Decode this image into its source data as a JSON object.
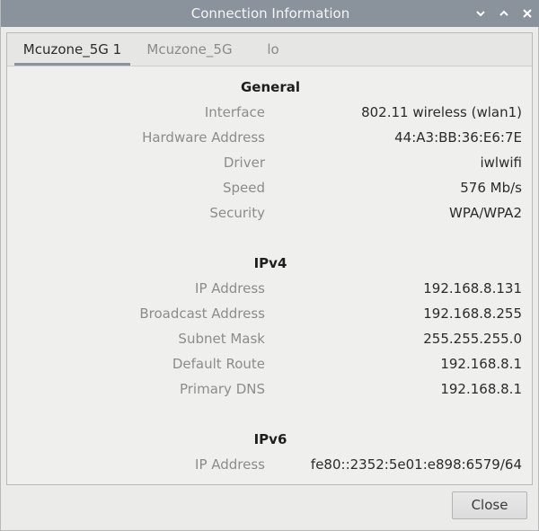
{
  "window": {
    "title": "Connection Information"
  },
  "titlebar_icons": {
    "minimize": "chevron-down-icon",
    "maximize": "chevron-up-icon",
    "close": "close-icon"
  },
  "tabs": [
    {
      "label": "Mcuzone_5G 1",
      "active": true
    },
    {
      "label": "Mcuzone_5G",
      "active": false
    },
    {
      "label": "lo",
      "active": false
    }
  ],
  "general": {
    "title": "General",
    "rows": [
      {
        "label": "Interface",
        "value": "802.11 wireless (wlan1)"
      },
      {
        "label": "Hardware Address",
        "value": "44:A3:BB:36:E6:7E"
      },
      {
        "label": "Driver",
        "value": "iwlwifi"
      },
      {
        "label": "Speed",
        "value": "576 Mb/s"
      },
      {
        "label": "Security",
        "value": "WPA/WPA2"
      }
    ]
  },
  "ipv4": {
    "title": "IPv4",
    "rows": [
      {
        "label": "IP Address",
        "value": "192.168.8.131"
      },
      {
        "label": "Broadcast Address",
        "value": "192.168.8.255"
      },
      {
        "label": "Subnet Mask",
        "value": "255.255.255.0"
      },
      {
        "label": "Default Route",
        "value": "192.168.8.1"
      },
      {
        "label": "Primary DNS",
        "value": "192.168.8.1"
      }
    ]
  },
  "ipv6": {
    "title": "IPv6",
    "rows": [
      {
        "label": "IP Address",
        "value": "fe80::2352:5e01:e898:6579/64"
      }
    ]
  },
  "footer": {
    "close_label": "Close"
  },
  "colors": {
    "titlebar": "#8a929c",
    "tab_indicator": "#8a929c",
    "label_text": "#8c8c8c",
    "value_text": "#2b2b2b"
  }
}
